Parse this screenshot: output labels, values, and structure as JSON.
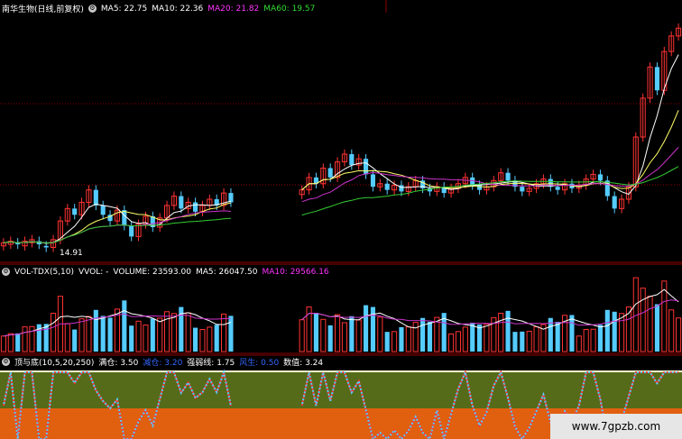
{
  "main_panel": {
    "title": "南华生物(日线,前复权)",
    "indicators": [
      {
        "label": "MA5: 22.75",
        "color": "#ffffff"
      },
      {
        "label": "MA10: 22.36",
        "color": "#ffffff"
      },
      {
        "label": "MA20: 21.82",
        "color": "#ff33ff"
      },
      {
        "label": "MA60: 19.57",
        "color": "#33dd33"
      }
    ],
    "low_marker": "14.91"
  },
  "volume_panel": {
    "title": "VOL-TDX(5,10)",
    "vvol": "VVOL: -",
    "items": [
      {
        "label": "VOLUME: 23593.00",
        "color": "#ffffff"
      },
      {
        "label": "MA5: 26047.50",
        "color": "#ffffff"
      },
      {
        "label": "MA10: 29566.16",
        "color": "#ff33ff"
      }
    ]
  },
  "indicator_panel": {
    "title": "顶与底(10,5,20,250)",
    "items": [
      {
        "label": "满仓: 3.50",
        "color": "#ffffff"
      },
      {
        "label": "减仓: 3.20",
        "color": "#3366ff"
      },
      {
        "label": "强弱线: 1.75",
        "color": "#ffffff"
      },
      {
        "label": "风生: 0.50",
        "color": "#3366ff"
      },
      {
        "label": "数值: 3.24",
        "color": "#ffffff"
      }
    ]
  },
  "watermark": "www.7gpzb.com",
  "colors": {
    "up": "#ff3333",
    "down": "#55ccff",
    "grid": "#8b0000",
    "ma_white": "#ffffff",
    "ma_yellow": "#ffff66",
    "ma_magenta": "#cc33cc",
    "ma_green": "#33cc33",
    "band_olive": "#556b1a",
    "band_orange": "#e06010",
    "band_line": "#ffffcc"
  },
  "chart_data": {
    "type": "candlestick",
    "note_series": "price values estimated from the screenshot",
    "price_min": 14.0,
    "price_max": 30.0,
    "candles": [
      {
        "o": 15.0,
        "c": 15.2
      },
      {
        "o": 15.1,
        "c": 15.3
      },
      {
        "o": 15.2,
        "c": 15.1
      },
      {
        "o": 15.0,
        "c": 15.3
      },
      {
        "o": 15.2,
        "c": 15.4
      },
      {
        "o": 15.3,
        "c": 15.1
      },
      {
        "o": 15.0,
        "c": 14.9
      },
      {
        "o": 14.9,
        "c": 15.4
      },
      {
        "o": 15.4,
        "c": 16.6
      },
      {
        "o": 16.6,
        "c": 17.4
      },
      {
        "o": 17.4,
        "c": 17.0
      },
      {
        "o": 17.0,
        "c": 17.8
      },
      {
        "o": 17.8,
        "c": 18.6
      },
      {
        "o": 18.6,
        "c": 17.6
      },
      {
        "o": 17.6,
        "c": 17.0
      },
      {
        "o": 17.0,
        "c": 16.6
      },
      {
        "o": 16.6,
        "c": 17.3
      },
      {
        "o": 17.3,
        "c": 16.3
      },
      {
        "o": 16.3,
        "c": 15.6
      },
      {
        "o": 15.6,
        "c": 16.4
      },
      {
        "o": 16.4,
        "c": 16.9
      },
      {
        "o": 16.9,
        "c": 16.2
      },
      {
        "o": 16.2,
        "c": 16.8
      },
      {
        "o": 16.8,
        "c": 17.6
      },
      {
        "o": 17.6,
        "c": 18.2
      },
      {
        "o": 18.2,
        "c": 17.4
      },
      {
        "o": 17.4,
        "c": 17.8
      },
      {
        "o": 17.8,
        "c": 17.2
      },
      {
        "o": 17.2,
        "c": 17.6
      },
      {
        "o": 17.6,
        "c": 18.0
      },
      {
        "o": 18.0,
        "c": 17.6
      },
      {
        "o": 17.6,
        "c": 18.4
      },
      {
        "o": 18.4,
        "c": 17.8
      },
      null,
      null,
      null,
      null,
      null,
      null,
      null,
      null,
      null,
      {
        "o": 18.3,
        "c": 18.6
      },
      {
        "o": 18.6,
        "c": 19.4
      },
      {
        "o": 19.4,
        "c": 19.0
      },
      {
        "o": 19.0,
        "c": 20.0
      },
      {
        "o": 20.0,
        "c": 19.4
      },
      {
        "o": 19.4,
        "c": 20.4
      },
      {
        "o": 20.4,
        "c": 20.9
      },
      {
        "o": 20.9,
        "c": 20.2
      },
      {
        "o": 20.2,
        "c": 20.6
      },
      {
        "o": 20.6,
        "c": 19.6
      },
      {
        "o": 19.6,
        "c": 18.8
      },
      {
        "o": 18.8,
        "c": 19.0
      },
      {
        "o": 19.0,
        "c": 18.6
      },
      {
        "o": 18.6,
        "c": 18.9
      },
      {
        "o": 18.9,
        "c": 18.5
      },
      {
        "o": 18.5,
        "c": 18.8
      },
      {
        "o": 18.8,
        "c": 19.2
      },
      {
        "o": 19.2,
        "c": 18.7
      },
      {
        "o": 18.7,
        "c": 18.5
      },
      {
        "o": 18.5,
        "c": 18.8
      },
      {
        "o": 18.8,
        "c": 18.4
      },
      {
        "o": 18.4,
        "c": 18.7
      },
      {
        "o": 18.7,
        "c": 19.0
      },
      {
        "o": 19.0,
        "c": 19.4
      },
      {
        "o": 19.4,
        "c": 18.9
      },
      {
        "o": 18.9,
        "c": 18.6
      },
      {
        "o": 18.6,
        "c": 18.8
      },
      {
        "o": 18.8,
        "c": 19.2
      },
      {
        "o": 19.2,
        "c": 19.7
      },
      {
        "o": 19.7,
        "c": 19.2
      },
      {
        "o": 19.2,
        "c": 18.8
      },
      {
        "o": 18.8,
        "c": 18.5
      },
      {
        "o": 18.5,
        "c": 18.7
      },
      {
        "o": 18.7,
        "c": 19.0
      },
      {
        "o": 19.0,
        "c": 19.3
      },
      {
        "o": 19.3,
        "c": 18.8
      },
      {
        "o": 18.8,
        "c": 18.6
      },
      {
        "o": 18.6,
        "c": 19.0
      },
      {
        "o": 19.0,
        "c": 18.7
      },
      {
        "o": 18.7,
        "c": 18.9
      },
      {
        "o": 18.9,
        "c": 19.3
      },
      {
        "o": 19.3,
        "c": 19.6
      },
      {
        "o": 19.6,
        "c": 19.2
      },
      {
        "o": 19.2,
        "c": 18.2
      },
      {
        "o": 18.2,
        "c": 17.4
      },
      {
        "o": 17.4,
        "c": 18.0
      },
      {
        "o": 18.0,
        "c": 18.8
      },
      {
        "o": 18.8,
        "c": 22.0
      },
      {
        "o": 22.0,
        "c": 24.5
      },
      {
        "o": 24.5,
        "c": 26.5
      },
      {
        "o": 26.5,
        "c": 25.0
      },
      {
        "o": 25.0,
        "c": 27.5
      },
      {
        "o": 27.5,
        "c": 28.5
      },
      {
        "o": 28.5,
        "c": 29.0
      }
    ],
    "volume_min": 0,
    "volume_max": 80000
  }
}
